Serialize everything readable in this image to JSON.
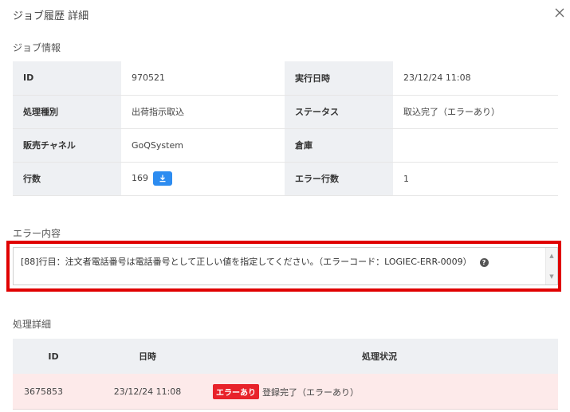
{
  "modal": {
    "title": "ジョブ履歴 詳細"
  },
  "job_info": {
    "section_title": "ジョブ情報",
    "rows": [
      {
        "label1": "ID",
        "value1": "970521",
        "label2": "実行日時",
        "value2": "23/12/24 11:08"
      },
      {
        "label1": "処理種別",
        "value1": "出荷指示取込",
        "label2": "ステータス",
        "value2": "取込完了（エラーあり）"
      },
      {
        "label1": "販売チャネル",
        "value1": "GoQSystem",
        "label2": "倉庫",
        "value2": ""
      },
      {
        "label1": "行数",
        "value1": "169",
        "label2": "エラー行数",
        "value2": "1"
      }
    ]
  },
  "error": {
    "section_title": "エラー内容",
    "message": "[88]行目：注文者電話番号は電話番号として正しい値を指定してください。（エラーコード：LOGIEC-ERR-0009）",
    "help_glyph": "?"
  },
  "process": {
    "section_title": "処理詳細",
    "headers": [
      "ID",
      "日時",
      "処理状況"
    ],
    "rows": [
      {
        "id": "3675853",
        "datetime": "23/12/24 11:08",
        "badge": "エラーあり",
        "status": "登録完了（エラーあり）"
      }
    ]
  },
  "icons": {
    "close": "close-icon",
    "download": "download-icon",
    "help": "help-icon"
  },
  "colors": {
    "highlight": "#e00000",
    "badge": "#e8222a",
    "download_button": "#2d8cf0",
    "error_row": "#fdeaea"
  }
}
